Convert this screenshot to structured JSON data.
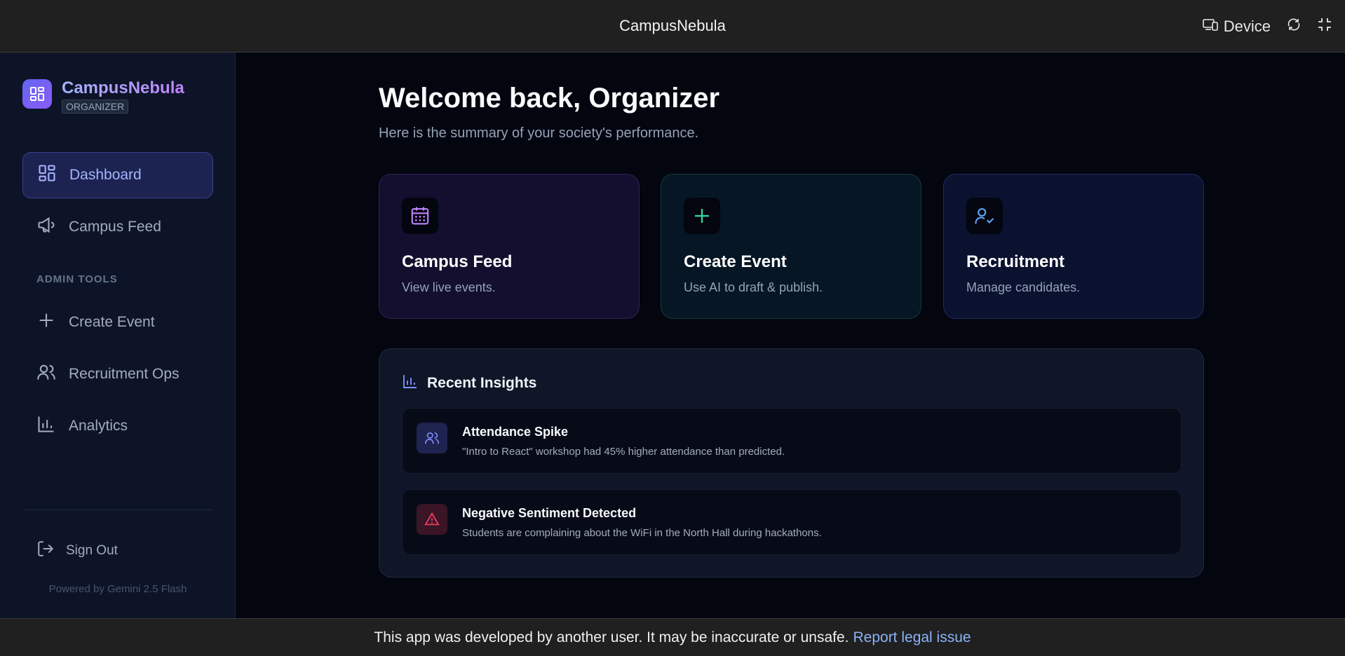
{
  "topbar": {
    "title": "CampusNebula",
    "device_label": "Device",
    "icons": [
      "device-icon",
      "rotate-icon",
      "fullscreen-exit-icon"
    ]
  },
  "sidebar": {
    "brand_name": "CampusNebula",
    "brand_role": "ORGANIZER",
    "items": [
      {
        "label": "Dashboard",
        "icon": "dashboard-icon",
        "active": true
      },
      {
        "label": "Campus Feed",
        "icon": "megaphone-icon",
        "active": false
      }
    ],
    "section_label": "ADMIN TOOLS",
    "admin_items": [
      {
        "label": "Create Event",
        "icon": "plus-icon"
      },
      {
        "label": "Recruitment Ops",
        "icon": "users-icon"
      },
      {
        "label": "Analytics",
        "icon": "bar-chart-icon"
      }
    ],
    "signout_label": "Sign Out",
    "powered_by": "Powered by Gemini 2.5 Flash"
  },
  "main": {
    "welcome": "Welcome back, Organizer",
    "subtitle": "Here is the summary of your society's performance.",
    "cards": [
      {
        "title": "Campus Feed",
        "desc": "View live events.",
        "icon": "calendar-icon",
        "color": "#c084fc"
      },
      {
        "title": "Create Event",
        "desc": "Use AI to draft & publish.",
        "icon": "plus-icon",
        "color": "#34d399"
      },
      {
        "title": "Recruitment",
        "desc": "Manage candidates.",
        "icon": "user-check-icon",
        "color": "#60a5fa"
      }
    ],
    "insights": {
      "title": "Recent Insights",
      "items": [
        {
          "title": "Attendance Spike",
          "desc": "\"Intro to React\" workshop had 45% higher attendance than predicted.",
          "icon": "users-icon",
          "color": "#818cf8"
        },
        {
          "title": "Negative Sentiment Detected",
          "desc": "Students are complaining about the WiFi in the North Hall during hackathons.",
          "icon": "warning-icon",
          "color": "#f43f5e"
        }
      ]
    }
  },
  "bottombar": {
    "notice": "This app was developed by another user. It may be inaccurate or unsafe.",
    "report_link": "Report legal issue"
  }
}
